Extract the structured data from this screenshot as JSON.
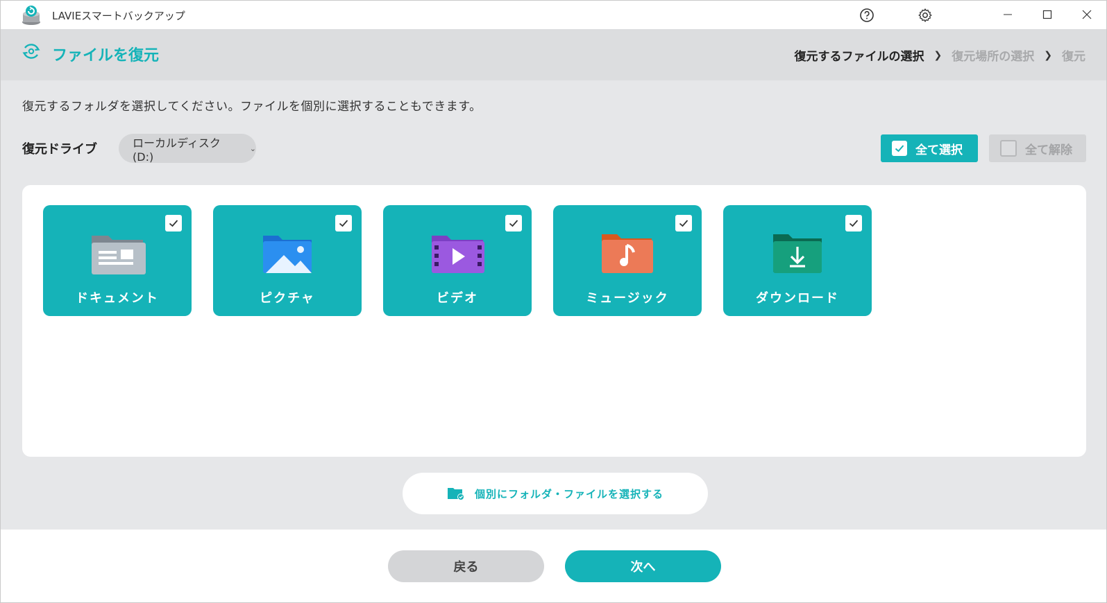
{
  "app": {
    "title": "LAVIEスマートバックアップ"
  },
  "header": {
    "title": "ファイルを復元",
    "steps": [
      {
        "label": "復元するファイルの選択",
        "active": true
      },
      {
        "label": "復元場所の選択",
        "active": false
      },
      {
        "label": "復元",
        "active": false
      }
    ]
  },
  "main": {
    "instruction": "復元するフォルダを選択してください。ファイルを個別に選択することもできます。",
    "drive_label": "復元ドライブ",
    "drive_value": "ローカルディスク (D:)",
    "select_all_label": "全て選択",
    "deselect_all_label": "全て解除",
    "folders": [
      {
        "label": "ドキュメント",
        "checked": true,
        "icon": "documents-folder-icon"
      },
      {
        "label": "ピクチャ",
        "checked": true,
        "icon": "pictures-folder-icon"
      },
      {
        "label": "ビデオ",
        "checked": true,
        "icon": "video-folder-icon"
      },
      {
        "label": "ミュージック",
        "checked": true,
        "icon": "music-folder-icon"
      },
      {
        "label": "ダウンロード",
        "checked": true,
        "icon": "downloads-folder-icon"
      }
    ],
    "individual_select_label": "個別にフォルダ・ファイルを選択する"
  },
  "footer": {
    "back_label": "戻る",
    "next_label": "次へ"
  },
  "colors": {
    "accent": "#15b3b8",
    "header_bg": "#dcdddf",
    "body_bg": "#e6e7e9"
  }
}
